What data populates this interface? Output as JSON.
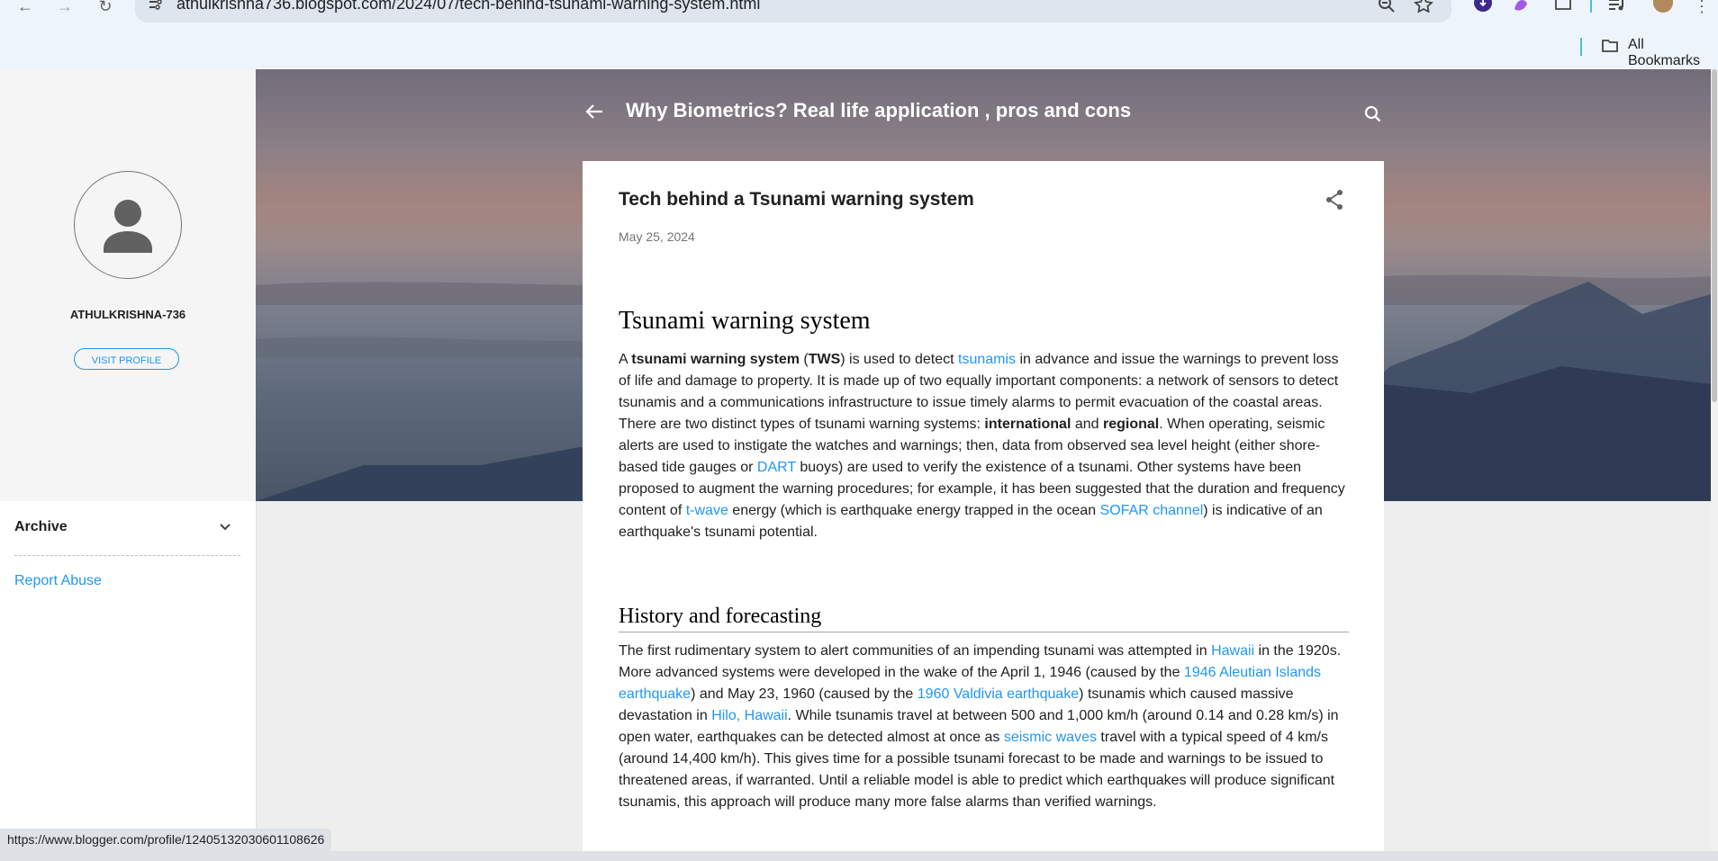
{
  "browser": {
    "url": "athulkrishna736.blogspot.com/2024/07/tech-behind-tsunami-warning-system.html",
    "all_bookmarks": "All Bookmarks"
  },
  "sidebar": {
    "profile_name": "ATHULKRISHNA-736",
    "visit_profile": "VISIT PROFILE",
    "archive": "Archive",
    "report_abuse": "Report Abuse"
  },
  "header": {
    "blog_title": "Why Biometrics? Real life application , pros and cons"
  },
  "post": {
    "title": "Tech behind a Tsunami warning system",
    "date": "May 25, 2024",
    "h_tsunami": "Tsunami warning system",
    "p1": {
      "t1": "A ",
      "b1": "tsunami warning system",
      "t2": " (",
      "b2": "TWS",
      "t3": ") is used to detect ",
      "l1": "tsunamis",
      "t4": " in advance and issue the warnings to prevent loss of life and damage to property. It is made up of two equally important components: a network of sensors to detect tsunamis and a communications infrastructure to issue timely alarms to permit evacuation of the coastal areas. There are two distinct types of tsunami warning systems: ",
      "b3": "international",
      "t5": " and ",
      "b4": "regional",
      "t6": ". When operating, seismic alerts are used to instigate the watches and warnings; then, data from observed sea level height (either shore-based tide gauges or ",
      "l2": "DART",
      "t7": " buoys) are used to verify the existence of a tsunami. Other systems have been proposed to augment the warning procedures; for example, it has been suggested that the duration and frequency content of ",
      "l3": "t-wave",
      "t8": " energy (which is earthquake energy trapped in the ocean ",
      "l4": "SOFAR channel",
      "t9": ") is indicative of an earthquake's tsunami potential."
    },
    "h_history": "History and forecasting",
    "p2": {
      "t1": "The first rudimentary system to alert communities of an impending tsunami was attempted in ",
      "l1": "Hawaii",
      "t2": " in the 1920s. More advanced systems were developed in the wake of the April 1, 1946 (caused by the ",
      "l2": "1946 Aleutian Islands earthquake",
      "t3": ") and May 23, 1960 (caused by the ",
      "l3": "1960 Valdivia earthquake",
      "t4": ") tsunamis which caused massive devastation in ",
      "l4": "Hilo, Hawaii",
      "t5": ". While tsunamis travel at between 500 and 1,000 km/h (around 0.14 and 0.28 km/s) in open water, earthquakes can be detected almost at once as ",
      "l5": "seismic waves",
      "t6": " travel with a typical speed of 4 km/s (around 14,400 km/h). This gives time for a possible tsunami forecast to be made and warnings to be issued to threatened areas, if warranted. Until a reliable model is able to predict which earthquakes will produce significant tsunamis, this approach will produce many more false alarms than verified warnings."
    }
  },
  "status_bar": {
    "link": "https://www.blogger.com/profile/12405132030601108626"
  },
  "colors": {
    "link": "#2196f3",
    "accent_sep": "#48c0d8"
  }
}
